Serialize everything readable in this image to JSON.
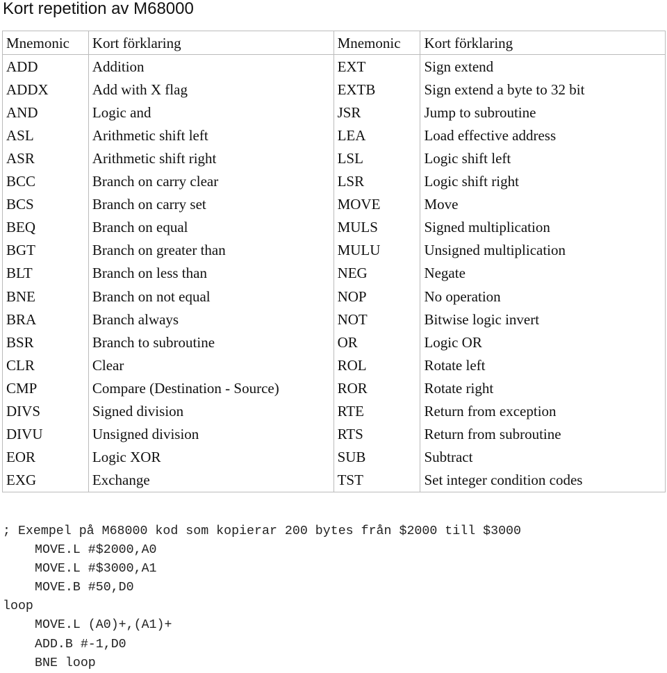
{
  "title": "Kort repetition av M68000",
  "table": {
    "headers": [
      "Mnemonic",
      "Kort förklaring",
      "Mnemonic",
      "Kort förklaring"
    ],
    "rows": [
      [
        "ADD",
        "Addition",
        "EXT",
        "Sign extend"
      ],
      [
        "ADDX",
        "Add with X flag",
        "EXTB",
        "Sign extend a byte to 32 bit"
      ],
      [
        "AND",
        "Logic and",
        "JSR",
        "Jump to subroutine"
      ],
      [
        "ASL",
        "Arithmetic shift left",
        "LEA",
        "Load effective address"
      ],
      [
        "ASR",
        "Arithmetic shift right",
        "LSL",
        "Logic shift left"
      ],
      [
        "BCC",
        "Branch on carry clear",
        "LSR",
        "Logic shift right"
      ],
      [
        "BCS",
        "Branch on carry set",
        "MOVE",
        "Move"
      ],
      [
        "BEQ",
        "Branch on equal",
        "MULS",
        "Signed multiplication"
      ],
      [
        "BGT",
        "Branch on greater than",
        "MULU",
        "Unsigned multiplication"
      ],
      [
        "BLT",
        "Branch on less than",
        "NEG",
        "Negate"
      ],
      [
        "BNE",
        "Branch on not equal",
        "NOP",
        "No operation"
      ],
      [
        "BRA",
        "Branch always",
        "NOT",
        "Bitwise logic invert"
      ],
      [
        "BSR",
        "Branch to subroutine",
        "OR",
        "Logic OR"
      ],
      [
        "CLR",
        "Clear",
        "ROL",
        "Rotate left"
      ],
      [
        "CMP",
        "Compare (Destination - Source)",
        "ROR",
        "Rotate right"
      ],
      [
        "DIVS",
        "Signed division",
        "RTE",
        "Return from exception"
      ],
      [
        "DIVU",
        "Unsigned division",
        "RTS",
        "Return from subroutine"
      ],
      [
        "EOR",
        "Logic XOR",
        "SUB",
        "Subtract"
      ],
      [
        "EXG",
        "Exchange",
        "TST",
        "Set integer condition codes"
      ]
    ]
  },
  "code": {
    "lines": [
      {
        "text": "; Exempel på M68000 kod som kopierar 200 bytes från $2000 till $3000",
        "indent": false
      },
      {
        "text": "MOVE.L #$2000,A0",
        "indent": true
      },
      {
        "text": "MOVE.L #$3000,A1",
        "indent": true
      },
      {
        "text": "MOVE.B #50,D0",
        "indent": true
      },
      {
        "text": "loop",
        "indent": false
      },
      {
        "text": "MOVE.L (A0)+,(A1)+",
        "indent": true
      },
      {
        "text": "ADD.B #-1,D0",
        "indent": true
      },
      {
        "text": "BNE loop",
        "indent": true
      }
    ]
  }
}
